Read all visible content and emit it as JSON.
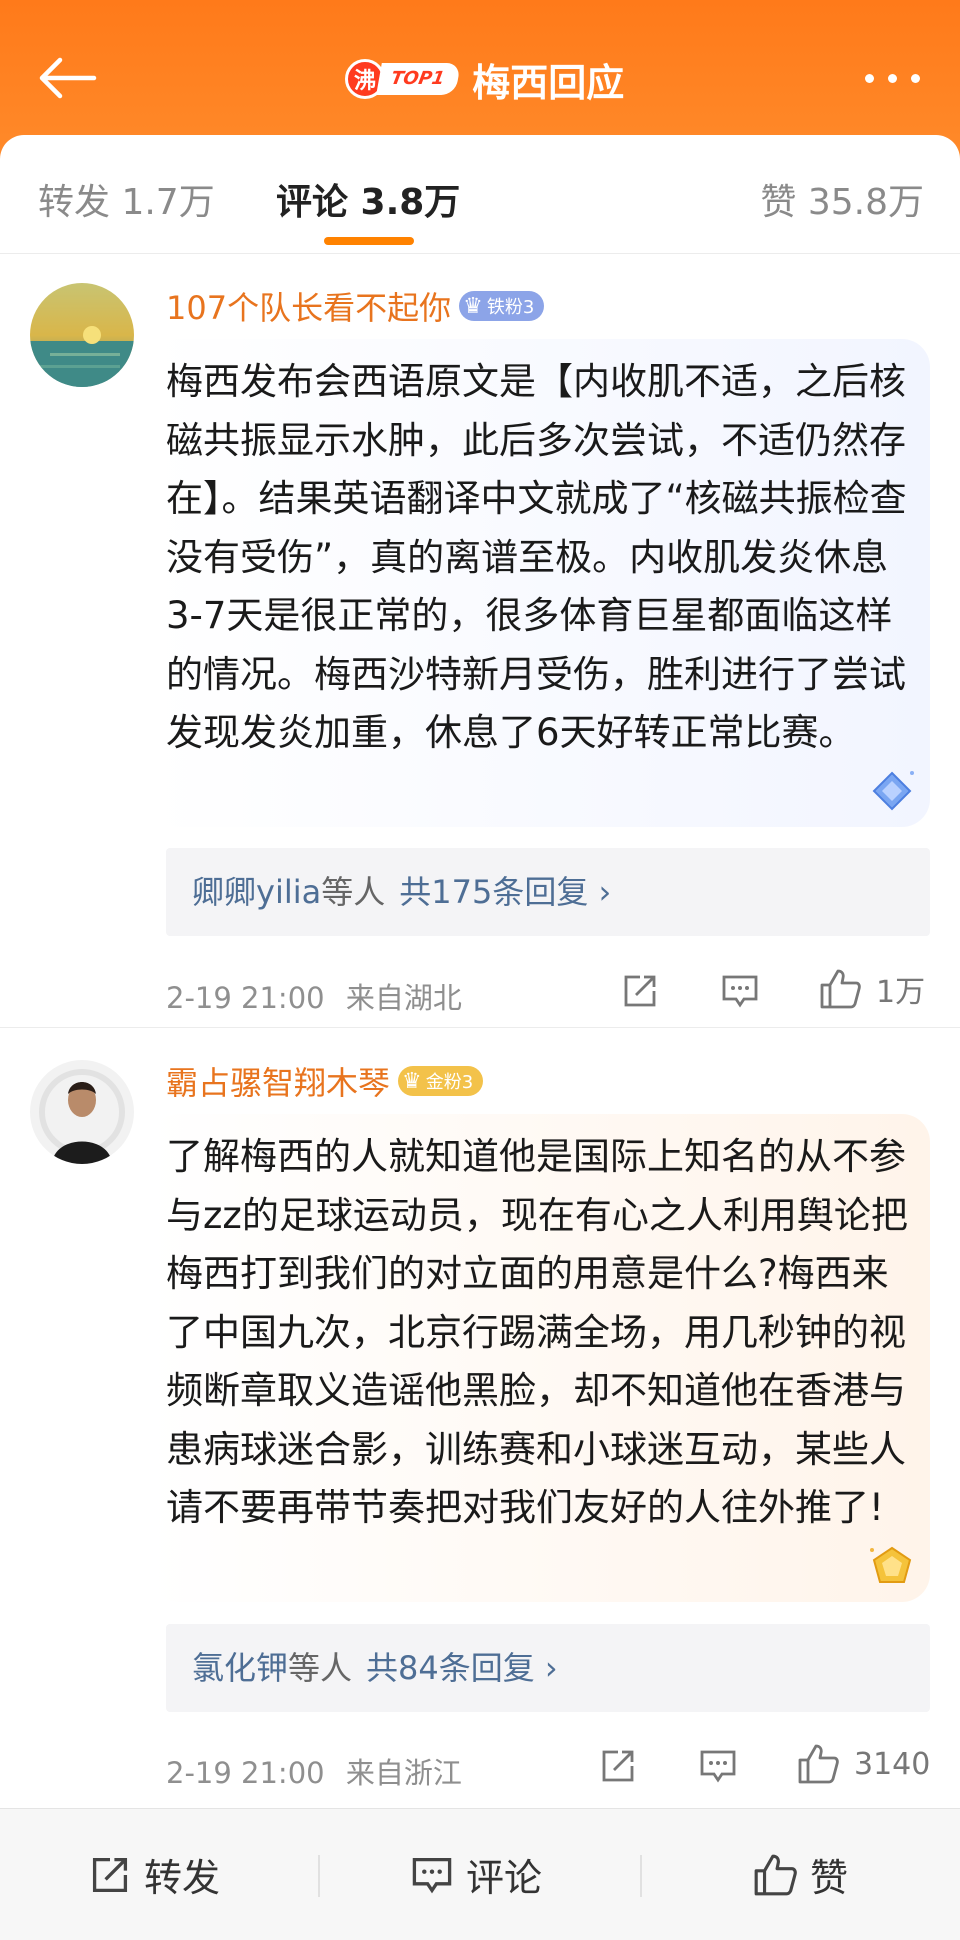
{
  "header": {
    "title": "梅西回应",
    "hot_badge": "沸",
    "rank_badge": "TOP1"
  },
  "tabs": [
    {
      "label": "转发 1.7万"
    },
    {
      "label": "评论 3.8万"
    },
    {
      "label": "赞 35.8万"
    }
  ],
  "comments": [
    {
      "username": "107个队长看不起你",
      "fan_badge": "铁粉3",
      "text": "梅西发布会西语原文是【内收肌不适，之后核磁共振显示水肿，此后多次尝试，不适仍然存在】。结果英语翻译中文就成了“核磁共振检查没有受伤”，真的离谱至极。内收肌发炎休息3-7天是很正常的，很多体育巨星都面临这样的情况。梅西沙特新月受伤，胜利进行了尝试发现发炎加重，休息了6天好转正常比赛。",
      "reply_user": "卿卿yilia",
      "reply_etc": "等人",
      "reply_count": "共175条回复 ›",
      "time": "2-19 21:00",
      "location": "来自湖北",
      "likes": "1万"
    },
    {
      "username": "霸占骡智翔木琴",
      "fan_badge": "金粉3",
      "text": "了解梅西的人就知道他是国际上知名的从不参与zz的足球运动员，现在有心之人利用舆论把梅西打到我们的对立面的用意是什么?梅西来了中国九次，北京行踢满全场，用几秒钟的视频断章取义造谣他黑脸，却不知道他在香港与患病球迷合影，训练赛和小球迷互动，某些人请不要再带节奏把对我们友好的人往外推了!",
      "reply_user": "氯化钾",
      "reply_etc": "等人",
      "reply_count": "共84条回复 ›",
      "time": "2-19 21:00",
      "location": "来自浙江",
      "likes": "3140"
    }
  ],
  "bottom_bar": {
    "repost": "转发",
    "comment": "评论",
    "like": "赞"
  },
  "colors": {
    "header_orange": "#ff7a1a",
    "username_orange": "#e8741e",
    "reply_blue": "#4e6e95",
    "tab_indicator": "#ff8200"
  }
}
